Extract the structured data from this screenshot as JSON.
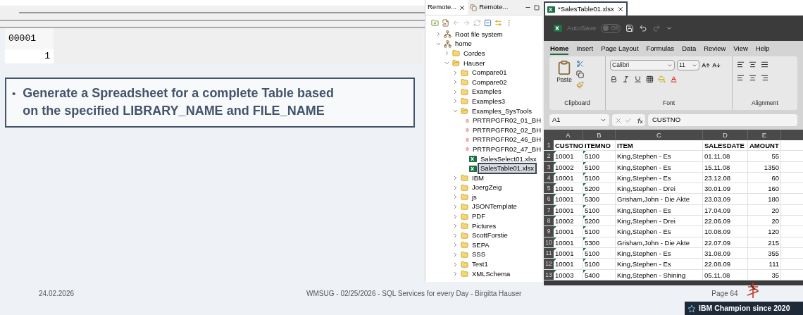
{
  "editor": {
    "lines": [
      {
        "text": "00001"
      },
      {
        "text": "1"
      }
    ]
  },
  "callout": {
    "bullet": "•",
    "text": "Generate a Spreadsheet for a complete Table based on the specified LIBRARY_NAME and FILE_NAME"
  },
  "explorer": {
    "tabs": [
      {
        "label": "Remote...",
        "selected": true,
        "closable": true
      },
      {
        "label": "Remote...",
        "selected": false,
        "closable": false
      }
    ],
    "tree": [
      {
        "label": "Root file system",
        "kind": "system",
        "expanded": false
      },
      {
        "label": "home",
        "kind": "system",
        "expanded": true,
        "children": [
          {
            "label": "Cordes",
            "kind": "folder",
            "expanded": false
          },
          {
            "label": "Hauser",
            "kind": "folder",
            "expanded": true,
            "children": [
              {
                "label": "Compare01",
                "kind": "folder",
                "expanded": false
              },
              {
                "label": "Compare02",
                "kind": "folder",
                "expanded": false
              },
              {
                "label": "Examples",
                "kind": "folder",
                "expanded": false
              },
              {
                "label": "Examples3",
                "kind": "folder",
                "expanded": false
              },
              {
                "label": "Examples_SysTools",
                "kind": "folder",
                "expanded": true,
                "children": [
                  {
                    "label": "PRTRPGFR02_01_BH",
                    "kind": "pdf",
                    "selected": false
                  },
                  {
                    "label": "PRTRPGFR02_02_BH",
                    "kind": "pdf",
                    "selected": false
                  },
                  {
                    "label": "PRTRPGFR02_46_BH",
                    "kind": "pdf",
                    "selected": false
                  },
                  {
                    "label": "PRTRPGFR02_47_BH",
                    "kind": "pdf",
                    "selected": false
                  },
                  {
                    "label": "SalesSelect01.xlsx",
                    "kind": "xlsx",
                    "selected": false
                  },
                  {
                    "label": "SalesTable01.xlsx",
                    "kind": "xlsx",
                    "selected": true
                  }
                ]
              },
              {
                "label": "IBM",
                "kind": "folder",
                "expanded": false
              },
              {
                "label": "JoergZeig",
                "kind": "folder",
                "expanded": false
              },
              {
                "label": "js",
                "kind": "folder",
                "expanded": false
              },
              {
                "label": "JSONTemplate",
                "kind": "folder",
                "expanded": false
              },
              {
                "label": "PDF",
                "kind": "folder",
                "expanded": false
              },
              {
                "label": "Pictures",
                "kind": "folder",
                "expanded": false
              },
              {
                "label": "ScottForstie",
                "kind": "folder",
                "expanded": false
              },
              {
                "label": "SEPA",
                "kind": "folder",
                "expanded": false
              },
              {
                "label": "SSS",
                "kind": "folder",
                "expanded": false
              },
              {
                "label": "Test1",
                "kind": "folder",
                "expanded": false
              },
              {
                "label": "XMLSchema",
                "kind": "folder",
                "expanded": false
              }
            ]
          }
        ]
      }
    ]
  },
  "excel": {
    "file_tab": "*SalesTable01.xlsx",
    "autosave": {
      "label": "AutoSave",
      "state": "Off",
      "on": false
    },
    "ribbon_tabs": [
      {
        "label": "Home",
        "selected": true
      },
      {
        "label": "Insert",
        "selected": false
      },
      {
        "label": "Page Layout",
        "selected": false
      },
      {
        "label": "Formulas",
        "selected": false
      },
      {
        "label": "Data",
        "selected": false
      },
      {
        "label": "Review",
        "selected": false
      },
      {
        "label": "View",
        "selected": false
      },
      {
        "label": "Help",
        "selected": false
      }
    ],
    "clipboard": {
      "paste": "Paste",
      "label": "Clipboard"
    },
    "font": {
      "name": "Calibri",
      "size": "11",
      "label": "Font"
    },
    "alignment": {
      "label": "Alignment"
    },
    "name_box": "A1",
    "formula": "CUSTNO",
    "columns": [
      {
        "letter": "A",
        "kind": "text",
        "flagged": true
      },
      {
        "letter": "B",
        "kind": "text",
        "flagged": true
      },
      {
        "letter": "C",
        "kind": "text",
        "flagged": false
      },
      {
        "letter": "D",
        "kind": "text",
        "flagged": false
      },
      {
        "letter": "E",
        "kind": "number",
        "flagged": false
      }
    ],
    "rows": [
      {
        "number": "1",
        "kind": "heading",
        "cells": [
          "CUSTNO",
          "ITEMNO",
          "ITEM",
          "SALESDATE",
          "AMOUNT"
        ]
      },
      {
        "number": "2",
        "kind": "data",
        "cells": [
          "10001",
          "5100",
          "King,Stephen - Es",
          "01.11.08",
          "55"
        ]
      },
      {
        "number": "3",
        "kind": "data",
        "cells": [
          "10002",
          "5100",
          "King,Stephen - Es",
          "15.11.08",
          "1350"
        ]
      },
      {
        "number": "4",
        "kind": "data",
        "cells": [
          "10001",
          "5100",
          "King,Stephen - Es",
          "23.12.08",
          "60"
        ]
      },
      {
        "number": "5",
        "kind": "data",
        "cells": [
          "10001",
          "5200",
          "King,Stephen - Drei",
          "30.01.09",
          "160"
        ]
      },
      {
        "number": "6",
        "kind": "data",
        "cells": [
          "10001",
          "5300",
          "Grisham,John - Die Akte",
          "23.03.09",
          "180"
        ]
      },
      {
        "number": "7",
        "kind": "data",
        "cells": [
          "10001",
          "5100",
          "King,Stephen - Es",
          "17.04.09",
          "20"
        ]
      },
      {
        "number": "8",
        "kind": "data",
        "cells": [
          "10002",
          "5200",
          "King,Stephen - Drei",
          "22.06.09",
          "20"
        ]
      },
      {
        "number": "9",
        "kind": "data",
        "cells": [
          "10001",
          "5100",
          "King,Stephen - Es",
          "10.08.09",
          "120"
        ]
      },
      {
        "number": "10",
        "kind": "data",
        "cells": [
          "10001",
          "5300",
          "Grisham,John - Die Akte",
          "22.07.09",
          "215"
        ]
      },
      {
        "number": "11",
        "kind": "data",
        "cells": [
          "10001",
          "5100",
          "King,Stephen - Es",
          "31.08.09",
          "355"
        ]
      },
      {
        "number": "12",
        "kind": "data",
        "cells": [
          "10001",
          "5100",
          "King,Stephen - Es",
          "22.08.09",
          "111"
        ]
      },
      {
        "number": "13",
        "kind": "data",
        "cells": [
          "10003",
          "5400",
          "King,Stephen - Shining",
          "05.11.08",
          "35"
        ]
      }
    ]
  },
  "footer": {
    "date": "24.02.2026",
    "title": "WMSUG - 02/25/2026 - SQL Services for every Day - Birgitta Hauser",
    "page": "Page 64",
    "badge": "IBM Champion since 2020"
  }
}
